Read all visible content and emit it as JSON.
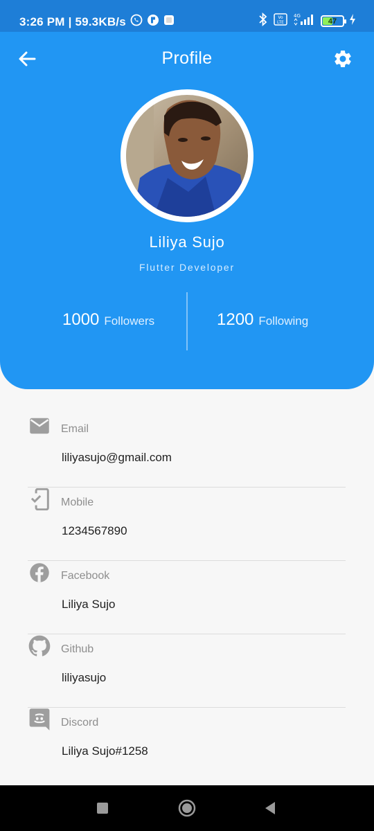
{
  "status_bar": {
    "time_speed": "3:26 PM | 59.3KB/s",
    "network": "4G",
    "volte": "Vo LTE",
    "battery": "47"
  },
  "header": {
    "title": "Profile",
    "back_icon": "arrow-back-icon",
    "settings_icon": "gear-icon",
    "background": "#2196f3"
  },
  "profile": {
    "name": "Liliya Sujo",
    "role": "Flutter Developer",
    "stats": [
      {
        "value": "1000",
        "label": "Followers"
      },
      {
        "value": "1200",
        "label": "Following"
      }
    ]
  },
  "info": [
    {
      "icon": "email-icon",
      "label": "Email",
      "value": "liliyasujo@gmail.com"
    },
    {
      "icon": "mobile-check-icon",
      "label": "Mobile",
      "value": "1234567890"
    },
    {
      "icon": "facebook-icon",
      "label": "Facebook",
      "value": "Liliya Sujo"
    },
    {
      "icon": "github-icon",
      "label": "Github",
      "value": "liliyasujo"
    },
    {
      "icon": "discord-icon",
      "label": "Discord",
      "value": "Liliya Sujo#1258"
    }
  ],
  "colors": {
    "accent": "#2196f3",
    "status_bar": "#1e7ed7",
    "icon_grey": "#9e9e9e"
  }
}
